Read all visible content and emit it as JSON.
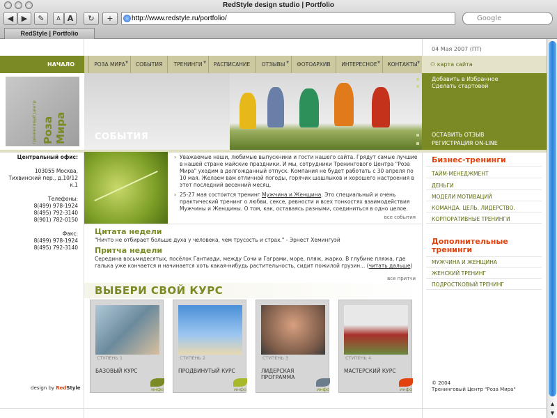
{
  "browser": {
    "window_title": "RedStyle design studio | Portfolio",
    "url": "http://www.redstyle.ru/portfolio/",
    "search_placeholder": "Google",
    "tab_label": "RedStyle | Portfolio",
    "back_glyph": "◀",
    "forward_glyph": "▶",
    "text_smaller_label": "A",
    "text_bigger_label": "A",
    "reload_glyph": "↻",
    "add_glyph": "+"
  },
  "header": {
    "date": "04 Мая 2007 (ПТ)",
    "sitemap": "карта сайта",
    "home": "НАЧАЛО",
    "nav": [
      "РОЗА МИРА",
      "СОБЫТИЯ",
      "ТРЕНИНГИ",
      "РАСПИСАНИЕ",
      "ОТЗЫВЫ",
      "ФОТОАРХИВ",
      "ИНТЕРЕСНОЕ",
      "КОНТАКТЫ"
    ],
    "logo_title": "Роза Мира",
    "logo_subtitle": "тренинговый центр",
    "hero_title": "СОБЫТИЯ"
  },
  "right_panel": {
    "fav": "Добавить в Избранное",
    "start": "Сделать стартовой",
    "feedback": "ОСТАВИТЬ ОТЗЫВ",
    "register": "РЕГИСТРАЦИЯ ON-LINE"
  },
  "office": {
    "heading": "Центральный офис:",
    "addr1": "103055 Москва,",
    "addr2": "Тихвинский пер., д.10/12 к.1",
    "phones_h": "Телефоны:",
    "phone1": "8(499) 978-1924",
    "phone2": "8(495) 792-3140",
    "phone3": "8(901) 782-0150",
    "fax_h": "Факс:",
    "fax1": "8(499) 978-1924",
    "fax2": "8(495) 792-3140"
  },
  "news": {
    "item1": "Уважаемые наши, любимые выпускники и гости нашего сайта. Грядут самые лучшие в нашей стране майские праздники. И мы, сотрудники Тренингового Центра \"Роза Мира\" уходим в  долгожданный отпуск. Компания не будет работать с 30 апреля по 10 мая. Желаем вам отличной погоды, горячих шашлыков и хорошего настроения в этот последний весенний месяц.",
    "item2_pre": "25-27 мая состоится тренинг ",
    "item2_link": "Мужчина и Женщина",
    "item2_post": ". Это специальный и очень практический тренинг о любви, сексе, ревности и всех тонкостях взаимодействия Мужчины и Женщины. О том, как, оставаясь разными, соединиться в одно целое.",
    "all": "все события"
  },
  "quote": {
    "heading": "Цитата недели",
    "text": "\"Ничто не отбирает больше духа у человека, чем трусость и страх.\" - Эрнест Хемингуэй"
  },
  "parable": {
    "heading": "Притча недели",
    "text": "Середина восьмидесятых, посёлок Гантиади, между Сочи и Гаграми, море, пляж, жарко. В глубине пляжа, где галька уже кончается и начинается хоть какая-нибудь растительность, сидит пожилой грузин... (",
    "link": "читать дальше",
    "close": ")",
    "all": "все притчи"
  },
  "courses": {
    "heading": "ВЫБЕРИ СВОЙ КУРС",
    "info": "инфо",
    "items": [
      {
        "step": "СТУПЕНЬ 1",
        "name": "БАЗОВЫЙ КУРС",
        "color": "#7b8a24"
      },
      {
        "step": "СТУПЕНЬ 2",
        "name": "ПРОДВИНУТЫЙ КУРС",
        "color": "#a8b82a"
      },
      {
        "step": "СТУПЕНЬ 3",
        "name": "ЛИДЕРСКАЯ ПРОГРАММА",
        "color": "#6b7d8c"
      },
      {
        "step": "СТУПЕНЬ 4",
        "name": "МАСТЕРСКИЙ КУРС",
        "color": "#e2430e"
      }
    ]
  },
  "business": {
    "heading": "Бизнес-тренинги",
    "items": [
      "ТАЙМ-МЕНЕДЖМЕНТ",
      "ДЕНЬГИ",
      "МОДЕЛИ МОТИВАЦИЙ",
      "КОМАНДА. ЦЕЛЬ. ЛИДЕРСТВО.",
      "КОРПОРАТИВНЫЕ ТРЕНИНГИ"
    ]
  },
  "extra": {
    "heading1": "Дополнительные",
    "heading2": "тренинги",
    "items": [
      "МУЖЧИНА И ЖЕНЩИНА",
      "ЖЕНСКИЙ ТРЕНИНГ",
      "ПОДРОСТКОВЫЙ ТРЕНИНГ"
    ]
  },
  "footer": {
    "design_pre": "design by ",
    "design_red": "Red",
    "design_style": "Style",
    "copy": "© 2004",
    "org": "Тренинговый Центр \"Роза Мира\""
  },
  "colors": {
    "accent": "#7b8a24",
    "red": "#e2430e",
    "nav_bg": "#ccc9a0"
  }
}
